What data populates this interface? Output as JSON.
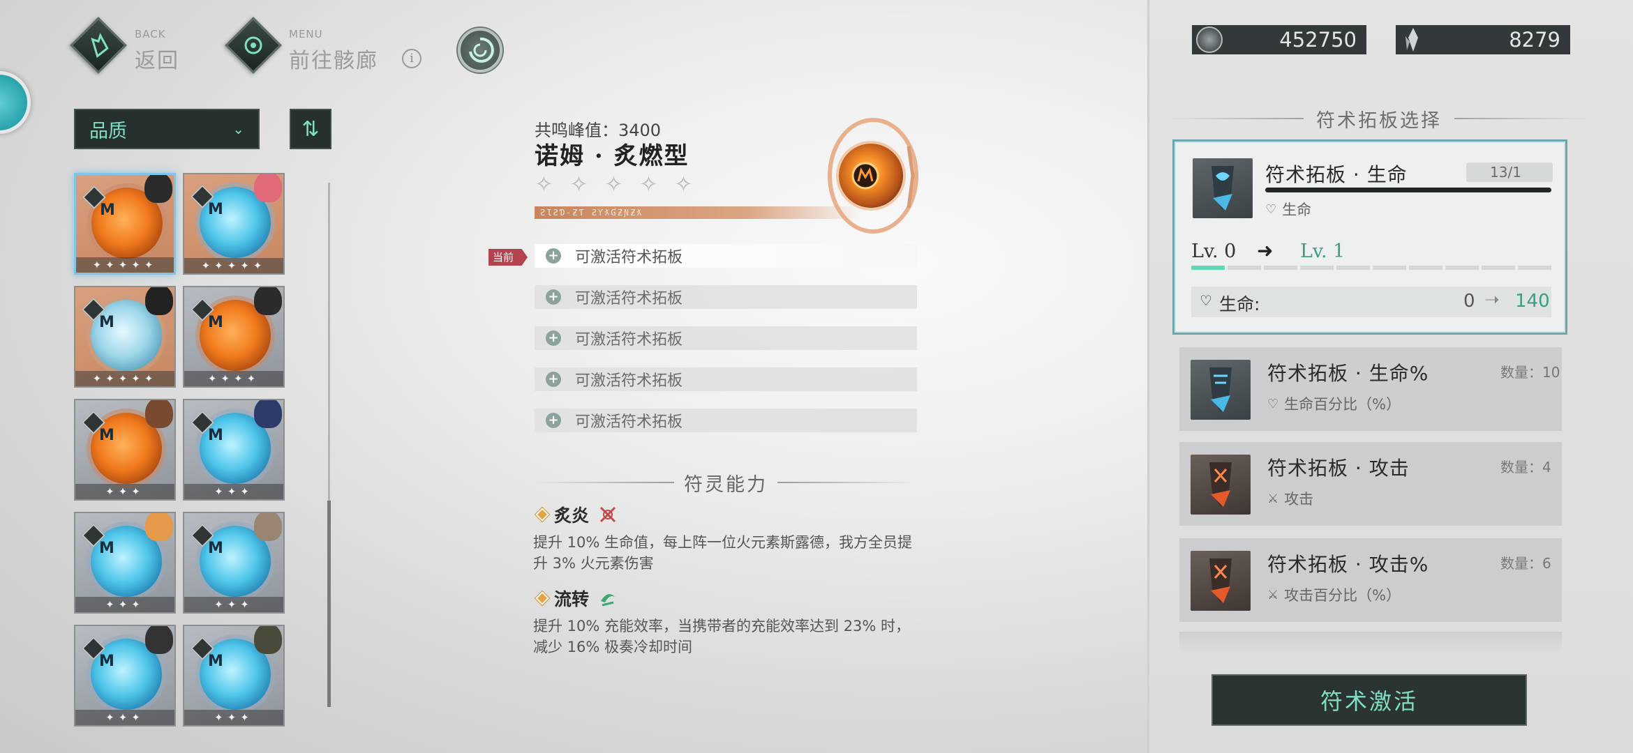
{
  "nav": {
    "back_small": "BACK",
    "back_label": "返回",
    "menu_small": "MENU",
    "menu_label": "前往骸廊",
    "info_icon": "i"
  },
  "filter": {
    "quality_label": "品质",
    "dropdown_icon": "chevron-down-icon",
    "sort_icon": "sort-icon"
  },
  "cards": [
    {
      "element": "fire",
      "stars": "✦✦✦✦✦",
      "selected": true
    },
    {
      "element": "ice",
      "stars": "✦✦✦✦✦",
      "selected": false
    },
    {
      "element": "ice-light",
      "stars": "✦✦✦✦✦",
      "selected": false
    },
    {
      "element": "fire",
      "stars": "✦✦✦✦",
      "selected": false
    },
    {
      "element": "fire",
      "stars": "✦✦✦",
      "selected": false
    },
    {
      "element": "ice",
      "stars": "✦✦✦",
      "selected": false
    },
    {
      "element": "ice",
      "stars": "✦✦✦",
      "selected": false
    },
    {
      "element": "ice",
      "stars": "✦✦✦",
      "selected": false
    },
    {
      "element": "ice",
      "stars": "✦✦✦",
      "selected": false
    },
    {
      "element": "ice",
      "stars": "✦✦✦",
      "selected": false
    }
  ],
  "detail": {
    "peak_label": "共鸣峰值：3400",
    "title": "诺姆 · 炙燃型",
    "rune_text": "ƧƖƧƊ-ƵƬ ƧƳƛƓƵƝƵƛ",
    "current_tag": "当前",
    "slots": [
      "可激活符术拓板",
      "可激活符术拓板",
      "可激活符术拓板",
      "可激活符术拓板",
      "可激活符术拓板"
    ],
    "ability_header": "符灵能力",
    "abilities": [
      {
        "name": "炙炎",
        "desc": "提升 10% 生命值，每上阵一位火元素斯露德，我方全员提升 3% 火元素伤害"
      },
      {
        "name": "流转",
        "desc": "提升 10% 充能效率，当携带者的充能效率达到 23% 时，减少 16% 极奏冷却时间"
      }
    ]
  },
  "currency": {
    "coins": "452750",
    "crystals": "8279"
  },
  "right": {
    "section_title": "符术拓板选择",
    "selected": {
      "name": "符术拓板 · 生命",
      "count": "13/1",
      "sub": "生命",
      "lv_from": "Lv. 0",
      "lv_to": "Lv. 1",
      "stat_label": "生命:",
      "stat_from": "0",
      "stat_to": "140",
      "level_progress": 0.1
    },
    "list": [
      {
        "name": "符术拓板 · 生命%",
        "count": "数量：10",
        "sub": "生命百分比（%）",
        "kind": "blue"
      },
      {
        "name": "符术拓板 · 攻击",
        "count": "数量：4",
        "sub": "攻击",
        "kind": "red"
      },
      {
        "name": "符术拓板 · 攻击%",
        "count": "数量：6",
        "sub": "攻击百分比（%）",
        "kind": "red"
      }
    ],
    "activate_label": "符术激活"
  }
}
